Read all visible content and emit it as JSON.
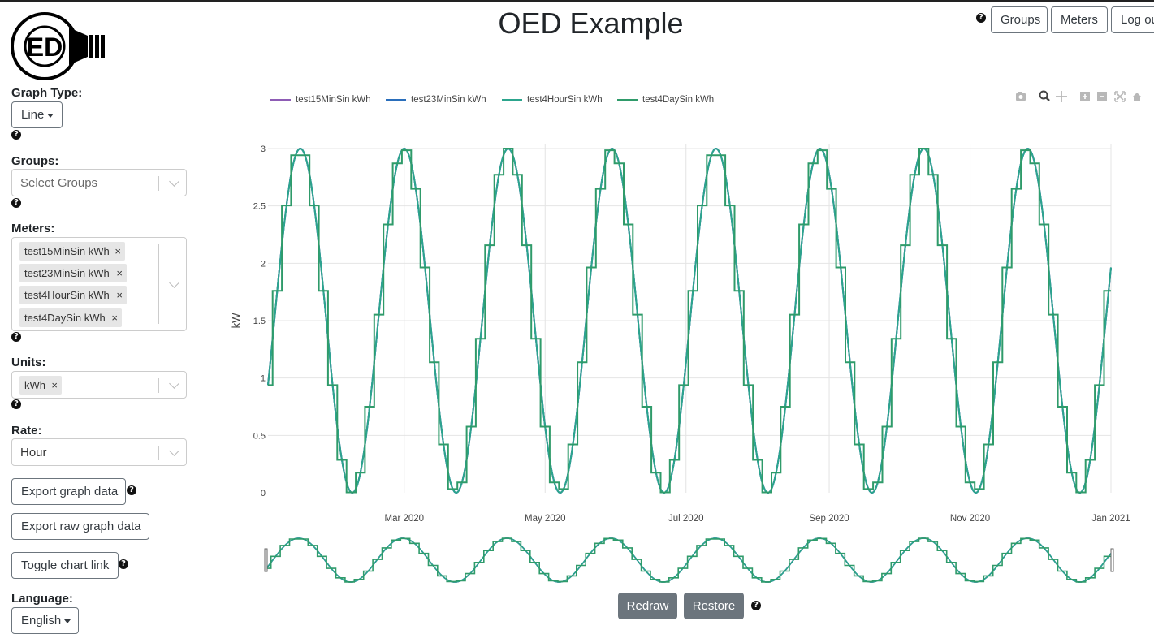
{
  "header": {
    "title": "OED Example",
    "logo_text": "ED",
    "nav": [
      "Groups",
      "Meters",
      "Log out"
    ]
  },
  "sidebar": {
    "graph_type": {
      "label": "Graph Type:",
      "value": "Line"
    },
    "groups": {
      "label": "Groups:",
      "placeholder": "Select Groups"
    },
    "meters": {
      "label": "Meters:",
      "selected": [
        "test15MinSin kWh",
        "test23MinSin kWh",
        "test4HourSin kWh",
        "test4DaySin kWh"
      ]
    },
    "units": {
      "label": "Units:",
      "selected": [
        "kWh"
      ]
    },
    "rate": {
      "label": "Rate:",
      "value": "Hour"
    },
    "buttons": {
      "export_graph": "Export graph data",
      "export_raw": "Export raw graph data",
      "toggle_link": "Toggle chart link"
    },
    "language": {
      "label": "Language:",
      "value": "English"
    }
  },
  "help_glyph": "?",
  "remove_glyph": "×",
  "modebar_icons": [
    "camera-icon",
    "zoom-icon",
    "pan-icon",
    "zoom-in-icon",
    "zoom-out-icon",
    "autoscale-icon",
    "reset-axes-icon"
  ],
  "footer_buttons": {
    "redraw": "Redraw",
    "restore": "Restore"
  },
  "colors": {
    "purple": "#8e5cb5",
    "blue": "#2a6ebb",
    "teal": "#2ca58d",
    "green": "#2f9b6a",
    "redraw_bg": "#6c757d"
  },
  "chart_data": {
    "type": "line",
    "ylabel": "kW",
    "ylim": [
      0,
      3
    ],
    "y_ticks": [
      "0",
      "0.5",
      "1",
      "1.5",
      "2",
      "2.5",
      "3"
    ],
    "x_ticks": [
      "Mar 2020",
      "May 2020",
      "Jul 2020",
      "Sep 2020",
      "Nov 2020",
      "Jan 2021"
    ],
    "x_tick_dates": [
      "2020-03-01",
      "2020-05-01",
      "2020-07-01",
      "2020-09-01",
      "2020-11-01",
      "2021-01-01"
    ],
    "x_range": [
      "2020-01-02",
      "2021-01-01"
    ],
    "grid": true,
    "legend_position": "top",
    "series": [
      {
        "name": "test15MinSin kWh",
        "color": "#8e5cb5",
        "shape": "sine",
        "amplitude": 1.5,
        "offset": 1.5,
        "period_days": 45,
        "peak_first": "2020-01-16"
      },
      {
        "name": "test23MinSin kWh",
        "color": "#2a6ebb",
        "shape": "sine",
        "amplitude": 1.5,
        "offset": 1.5,
        "period_days": 45,
        "peak_first": "2020-01-16"
      },
      {
        "name": "test4HourSin kWh",
        "color": "#2ca58d",
        "shape": "sine",
        "amplitude": 1.5,
        "offset": 1.5,
        "period_days": 45,
        "peak_first": "2020-01-16"
      },
      {
        "name": "test4DaySin kWh",
        "color": "#2f9b6a",
        "shape": "step",
        "step_days": 4,
        "amplitude": 1.5,
        "offset": 1.5,
        "period_days": 45,
        "peak_first": "2020-01-16"
      }
    ]
  }
}
